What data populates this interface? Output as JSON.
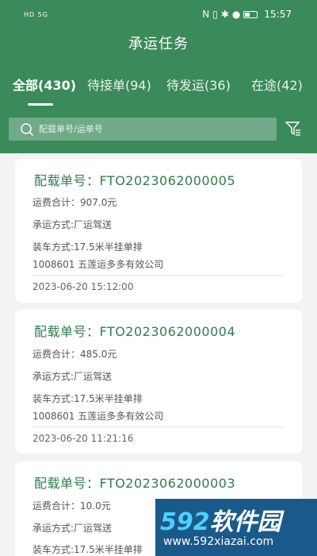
{
  "status_bar": {
    "left": "HD 5G",
    "right_icons": [
      "nfc-icon",
      "vibrate-icon",
      "bluetooth-icon",
      "location-icon"
    ],
    "time": "15:57"
  },
  "header": {
    "title": "承运任务",
    "accent": "#3a8a5a"
  },
  "tabs": [
    {
      "label": "全部(430)",
      "active": true
    },
    {
      "label": "待接单(94)",
      "active": false
    },
    {
      "label": "待发运(36)",
      "active": false
    },
    {
      "label": "在途(42)",
      "active": false
    }
  ],
  "search": {
    "placeholder": "配载单号/运单号",
    "value": ""
  },
  "filter_icon": "filter-icon",
  "orders": [
    {
      "title": "配载单号：FTO2023062000005",
      "freight": "运费合计：907.0元",
      "mode": "承运方式:厂运驾送",
      "truck": "装车方式:17.5米半挂单排",
      "company": "1008601 五莲运多多有效公司",
      "time": "2023-06-20 15:12:00"
    },
    {
      "title": "配载单号：FTO2023062000004",
      "freight": "运费合计：485.0元",
      "mode": "承运方式:厂运驾送",
      "truck": "装车方式:17.5米半挂单排",
      "company": "1008601 五莲运多多有效公司",
      "time": "2023-06-20 11:21:16"
    },
    {
      "title": "配载单号：FTO2023062000003",
      "freight": "运费合计：10.0元",
      "mode": "承运方式:厂运驾送",
      "truck": "装车方式:17.5米半挂单排"
    }
  ],
  "watermark": {
    "brand_num": "592",
    "brand_text": "软件园",
    "url": "www.592xiazai.com"
  }
}
